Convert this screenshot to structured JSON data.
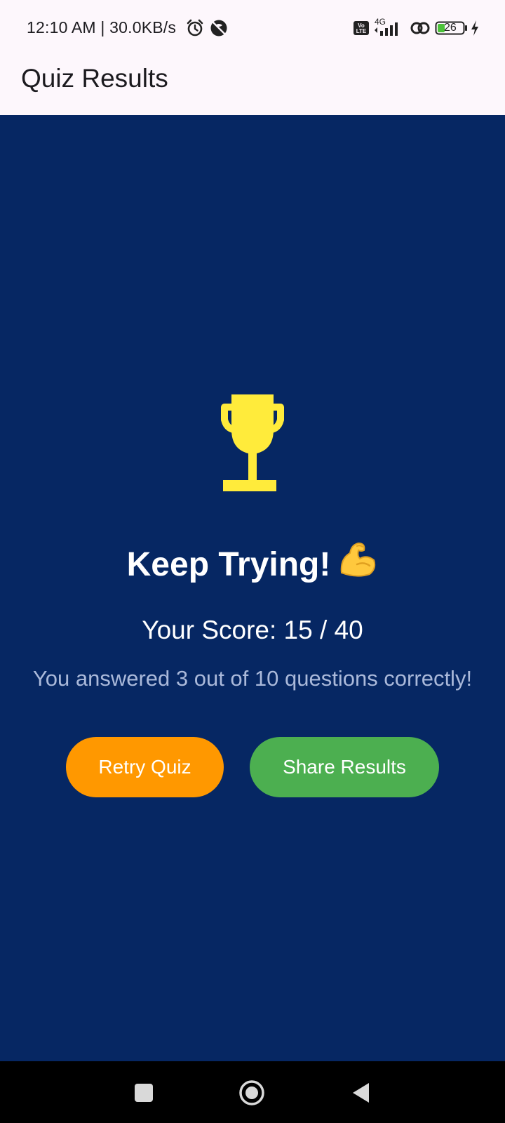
{
  "status_bar": {
    "time_text": "12:10 AM | 30.0KB/s",
    "network_type": "4G",
    "volte_label": "Vo LTE",
    "battery_level": "26",
    "icons": [
      "alarm-icon",
      "do-not-disturb-icon",
      "volte-icon",
      "signal-icon",
      "link-icon",
      "battery-icon",
      "charging-icon"
    ]
  },
  "app_bar": {
    "title": "Quiz Results"
  },
  "result": {
    "trophy_icon": "trophy-icon",
    "trophy_color": "#FFEB3B",
    "headline": "Keep Trying!",
    "headline_emoji": "flexed-biceps-icon",
    "score_text": "Your Score: 15 / 40",
    "summary_text": "You answered 3 out of 10 questions correctly!"
  },
  "actions": {
    "retry_label": "Retry Quiz",
    "retry_color": "#FF9800",
    "share_label": "Share Results",
    "share_color": "#4CAF50"
  },
  "nav_bar": {
    "buttons": [
      "recents-icon",
      "home-icon",
      "back-icon"
    ]
  },
  "colors": {
    "background": "#062763",
    "header_background": "#FDF7FC"
  }
}
